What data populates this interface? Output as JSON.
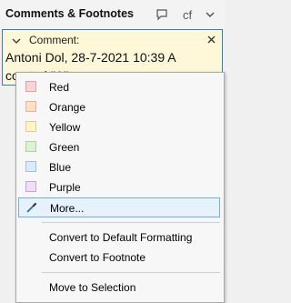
{
  "panel": {
    "title": "Comments & Footnotes",
    "cf_label": "cf"
  },
  "comment": {
    "label": "Comment:",
    "author_line": "Antoni Dol, 28-7-2021 10:39 A",
    "snippet": "co                         nted \"A\""
  },
  "menu": {
    "colors": [
      {
        "label": "Red",
        "fill": "#f9d4d4",
        "border": "#e0a4a4"
      },
      {
        "label": "Orange",
        "fill": "#fde0c6",
        "border": "#e6b48c"
      },
      {
        "label": "Yellow",
        "fill": "#fdf3c8",
        "border": "#e2d08a"
      },
      {
        "label": "Green",
        "fill": "#dff2d8",
        "border": "#a8d49b"
      },
      {
        "label": "Blue",
        "fill": "#dcebfa",
        "border": "#9cc0e6"
      },
      {
        "label": "Purple",
        "fill": "#f0ddf6",
        "border": "#c9a2da"
      }
    ],
    "more_label": "More...",
    "convert_default": "Convert to Default Formatting",
    "convert_footnote": "Convert to Footnote",
    "move_selection": "Move to Selection"
  }
}
